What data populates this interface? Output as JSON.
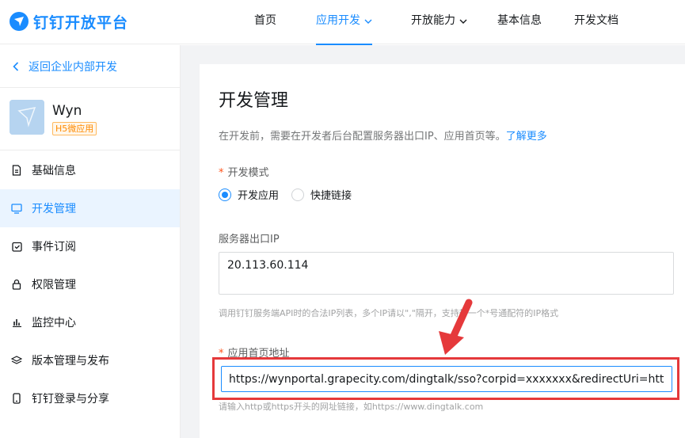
{
  "brand": {
    "name": "钉钉开放平台",
    "color": "#1a8cff"
  },
  "nav": {
    "items": [
      {
        "label": "首页"
      },
      {
        "label": "应用开发"
      },
      {
        "label": "开放能力"
      },
      {
        "label": "基本信息"
      },
      {
        "label": "开发文档"
      }
    ],
    "active_index": 1
  },
  "sidebar": {
    "back_label": "返回企业内部开发",
    "app": {
      "name": "Wyn",
      "tag": "H5微应用"
    },
    "items": [
      {
        "label": "基础信息",
        "icon": "document-icon"
      },
      {
        "label": "开发管理",
        "icon": "monitor-icon"
      },
      {
        "label": "事件订阅",
        "icon": "check-clipboard-icon"
      },
      {
        "label": "权限管理",
        "icon": "lock-icon"
      },
      {
        "label": "监控中心",
        "icon": "bar-chart-icon"
      },
      {
        "label": "版本管理与发布",
        "icon": "layers-icon"
      },
      {
        "label": "钉钉登录与分享",
        "icon": "phone-icon"
      }
    ],
    "active_index": 1
  },
  "main": {
    "title": "开发管理",
    "description": "在开发前，需要在开发者后台配置服务器出口IP、应用首页等。",
    "learn_more": "了解更多",
    "dev_mode": {
      "label": "开发模式",
      "options": [
        "开发应用",
        "快捷链接"
      ],
      "selected": "开发应用"
    },
    "server_ip": {
      "label": "服务器出口IP",
      "value": "20.113.60.114",
      "hint": "调用钉钉服务端API时的合法IP列表，多个IP请以\",\"隔开，支持带一个*号通配符的IP格式"
    },
    "homepage": {
      "label": "应用首页地址",
      "value": "https://wynportal.grapecity.com/dingtalk/sso?corpid=xxxxxxx&redirectUri=https:/",
      "hint": "请输入http或https开头的网址链接，如https://www.dingtalk.com"
    }
  },
  "colors": {
    "accent": "#1a8cff",
    "highlight": "#e5393b",
    "tag": "#ff8a00",
    "required": "#ff5219"
  }
}
